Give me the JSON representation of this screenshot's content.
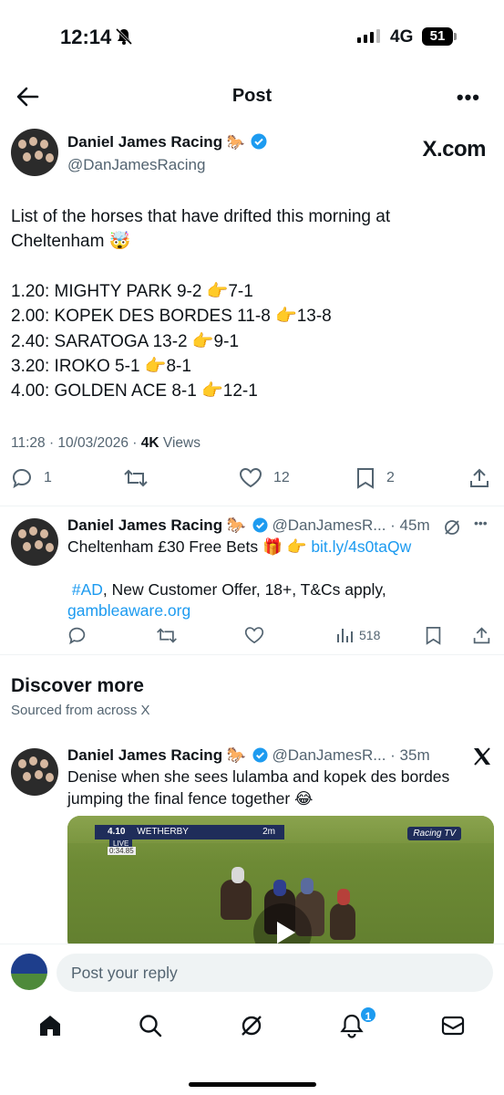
{
  "status_bar": {
    "time": "12:14",
    "network": "4G",
    "battery": "51"
  },
  "header": {
    "title": "Post"
  },
  "main_tweet": {
    "author": "Daniel James Racing",
    "author_emoji": "🐎",
    "handle": "@DanJamesRacing",
    "brand": "X.com",
    "intro": "List of the horses that have drifted this morning at Cheltenham 🤯",
    "lines": [
      "1.20: MIGHTY PARK 9-2 👉7-1",
      "2.00: KOPEK DES BORDES 11-8 👉13-8",
      "2.40: SARATOGA 13-2 👉9-1",
      "3.20: IROKO 5-1 👉8-1",
      "4.00: GOLDEN ACE 8-1 👉12-1"
    ],
    "time": "11:28",
    "date": "10/03/2026",
    "views_count": "4K",
    "views_label": "Views",
    "replies": "1",
    "likes": "12",
    "bookmarks": "2"
  },
  "reply_tweet": {
    "author": "Daniel James Racing",
    "author_emoji": "🐎",
    "handle": "@DanJamesR...",
    "time": "45m",
    "text_prefix": "Cheltenham £30 Free Bets 🎁 👉 ",
    "link": "bit.ly/4s0taQw",
    "hashtag": "#AD",
    "text_suffix": ", New Customer Offer, 18+, T&Cs apply,",
    "link2": "gambleaware.org",
    "views": "518"
  },
  "discover": {
    "title": "Discover more",
    "subtitle": "Sourced from across X"
  },
  "discover_tweet": {
    "author": "Daniel James Racing",
    "author_emoji": "🐎",
    "handle": "@DanJamesR...",
    "time": "35m",
    "text": "Denise when she sees lulamba and kopek des bordes jumping the final fence together 😂",
    "video": {
      "race_time": "4.10",
      "course": "WETHERBY",
      "live": "LIVE",
      "clock": "0:34.85",
      "distance": "2m",
      "channel": "Racing TV"
    }
  },
  "reply_bar": {
    "placeholder": "Post your reply"
  },
  "nav": {
    "notifications_badge": "1"
  }
}
